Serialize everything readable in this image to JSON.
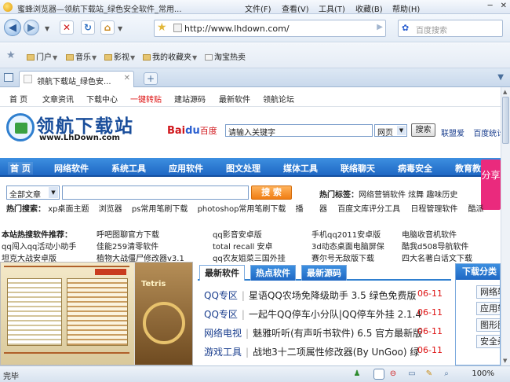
{
  "window": {
    "title": "蜜蜂浏览器—领航下载站_绿色安全软件_常用...",
    "menus": [
      "文件(F)",
      "查看(V)",
      "工具(T)",
      "收藏(B)",
      "帮助(H)"
    ]
  },
  "toolbar": {
    "url": "http://www.lhdown.com/",
    "search_placeholder": "百度搜索"
  },
  "favorites": [
    "门户",
    "音乐",
    "影视",
    "我的收藏夹",
    "淘宝热卖"
  ],
  "tab": {
    "title": "领航下载站_绿色安..."
  },
  "site": {
    "topnav": [
      "首 页",
      "文章资讯",
      "下载中心",
      "一键转贴",
      "建站源码",
      "最新软件",
      "领航论坛"
    ],
    "logo_cn": "领航下载站",
    "logo_en": "www.LhDown.com",
    "baidu_logo": "Bai",
    "baidu_logo_du": "du",
    "baidu_cn": "百度",
    "baidu_query": "请输入关键字",
    "baidu_select": "网页",
    "baidu_button": "搜索",
    "header_links": [
      "联盟爱",
      "百度统计"
    ],
    "menu": [
      "首 页",
      "网络软件",
      "系统工具",
      "应用软件",
      "图文处理",
      "媒体工具",
      "联络聊天",
      "病毒安全",
      "教育教"
    ],
    "share": "分享",
    "search_category": "全部文章",
    "search_button": "搜  索",
    "hot_tags_label": "热门标签：",
    "hot_tags": "网络营销软件   炫舞   趣味历史",
    "hot_search_label": "热门搜索：",
    "hot_search": [
      "xp桌面主题",
      "浏览器",
      "ps常用笔刷下载",
      "photoshop常用笔刷下载",
      "播"
    ],
    "tags_row2": [
      "器",
      "百度文库评分工具",
      "日程管理软件",
      "酷派"
    ],
    "rec_label": "本站热搜软件推荐：",
    "rec": [
      "呼吧图聊官方下载",
      "qq影音安卓版",
      "手机qq2011安卓版",
      "电脑收音机软件",
      "qq闯入qq活动小助手",
      "佳能259清零软件",
      "total recall 安卓",
      "3d动态桌面电脑屏保",
      "酷我d508导航软件",
      "坦克大战安卓版",
      "植物大战僵尸修改器v3.1",
      "qq农友姐菜三国外挂",
      "赛尔号无敌版下载",
      "四大名著白话文下载"
    ],
    "img_text": "Tetris",
    "list_tabs": [
      "最新软件",
      "热点软件",
      "最新源码"
    ],
    "list": [
      {
        "cat": "QQ专区",
        "name": "星语QQ农场免降级助手 3.5 绿色免费版",
        "date": "06-11"
      },
      {
        "cat": "QQ专区",
        "name": "一起牛QQ停车小分队|QQ停车外挂 2.1.4",
        "date": "06-11"
      },
      {
        "cat": "网络电视",
        "name": "魅雅听听(有声听书软件) 6.5 官方最新版",
        "date": "06-11"
      },
      {
        "cat": "游戏工具",
        "name": "战地3十二项属性修改器(By UnGoo) 绿",
        "date": "06-11"
      }
    ],
    "side_title": "下载分类",
    "side_items": [
      "网络软",
      "应用软",
      "图形图",
      "安全杀"
    ]
  },
  "status": {
    "text": "完毕",
    "zoom": "100%"
  }
}
